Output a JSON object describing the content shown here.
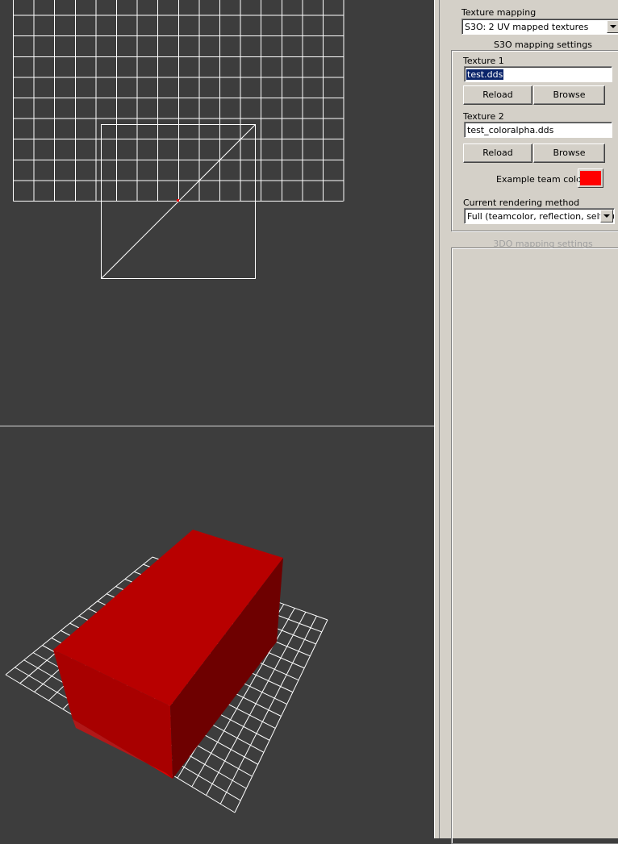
{
  "panel": {
    "texture_mapping_label": "Texture mapping",
    "texture_mapping_value": "S3O: 2 UV mapped textures",
    "s3o_group_title": "S3O mapping settings",
    "texture1_label": "Texture 1",
    "texture1_value": "test.dds",
    "texture1_reload": "Reload",
    "texture1_browse": "Browse",
    "texture2_label": "Texture 2",
    "texture2_value": "test_coloralpha.dds",
    "texture2_reload": "Reload",
    "texture2_browse": "Browse",
    "team_color_label": "Example team color:",
    "team_color": "#ff0000",
    "rendering_method_label": "Current rendering method",
    "rendering_method_value": "Full (teamcolor, reflection, self-illumination)",
    "s3d_group_title": "3DO mapping settings"
  },
  "colors": {
    "viewport_bg": "#3d3d3d",
    "grid": "#ffffff",
    "model_front": "#b30000",
    "model_top": "#b80000",
    "model_side": "#6e0000",
    "uv_vertex": "#ff0000"
  },
  "icons": {
    "combo_arrow": "chevron-down-icon"
  }
}
